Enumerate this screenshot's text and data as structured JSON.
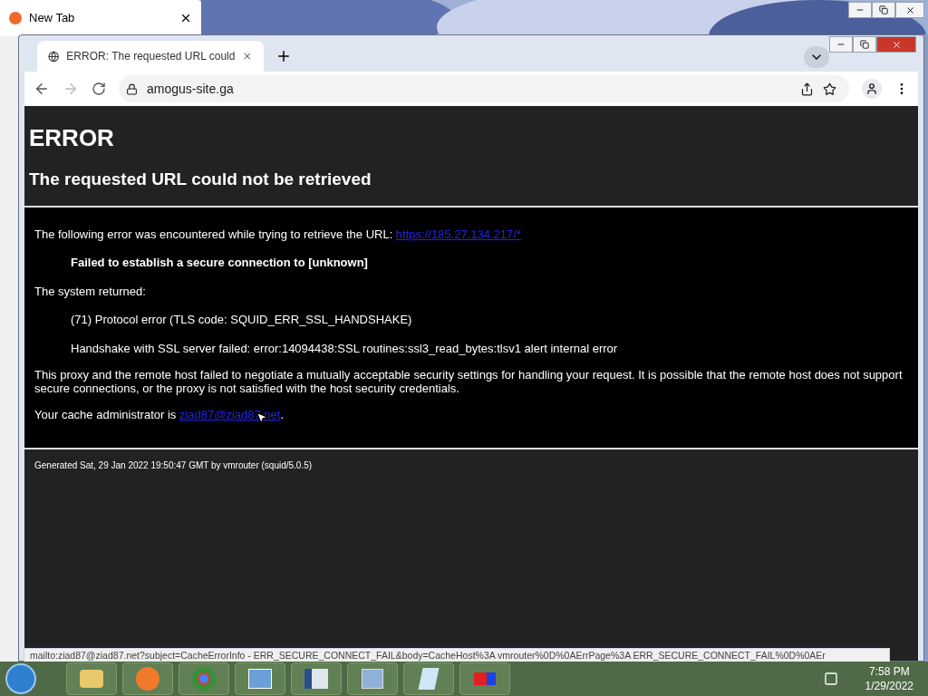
{
  "back_window": {
    "tab_title": "New Tab"
  },
  "browser": {
    "tab_title": "ERROR: The requested URL could",
    "address": "amogus-site.ga"
  },
  "page": {
    "heading": "ERROR",
    "subheading": "The requested URL could not be retrieved",
    "intro": "The following error was encountered while trying to retrieve the URL: ",
    "url_link": "https://185.27.134.217/*",
    "error_title": "Failed to establish a secure connection to [unknown]",
    "system_returned": "The system returned:",
    "details": [
      "(71) Protocol error (TLS code: SQUID_ERR_SSL_HANDSHAKE)",
      "Handshake with SSL server failed: error:14094438:SSL routines:ssl3_read_bytes:tlsv1 alert internal error"
    ],
    "explanation": "This proxy and the remote host failed to negotiate a mutually acceptable security settings for handling your request. It is possible that the remote host does not support secure connections, or the proxy is not satisfied with the host security credentials.",
    "admin_prefix": "Your cache administrator is ",
    "admin_link": "ziad87@ziad87.net",
    "admin_suffix": ".",
    "footer": "Generated Sat, 29 Jan 2022 19:50:47 GMT by vmrouter (squid/5.0.5)"
  },
  "status_bar": "mailto:ziad87@ziad87.net?subject=CacheErrorInfo - ERR_SECURE_CONNECT_FAIL&body=CacheHost%3A vmrouter%0D%0AErrPage%3A ERR_SECURE_CONNECT_FAIL%0D%0AEr",
  "clock": {
    "time": "7:58 PM",
    "date": "1/29/2022"
  }
}
